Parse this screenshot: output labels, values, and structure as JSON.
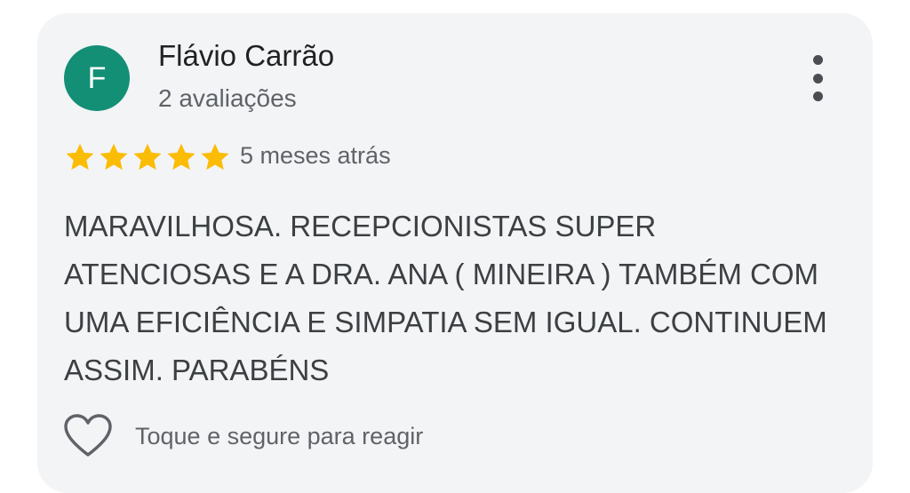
{
  "review": {
    "author": {
      "initial": "F",
      "name": "Flávio Carrão",
      "review_count": "2 avaliações",
      "avatar_color": "#138f76"
    },
    "rating": 5,
    "rating_max": 5,
    "star_color": "#fbbc04",
    "date": "5 meses atrás",
    "text": "MARAVILHOSA. RECEPCIONISTAS SUPER ATENCIOSAS E A DRA. ANA ( MINEIRA ) TAMBÉM COM UMA EFICIÊNCIA E SIMPATIA SEM IGUAL. CONTINUEM ASSIM. PARABÉNS",
    "react": {
      "label": "Toque e segure para reagir",
      "icon": "heart-outline-icon"
    },
    "menu_icon": "more-vertical-icon"
  }
}
